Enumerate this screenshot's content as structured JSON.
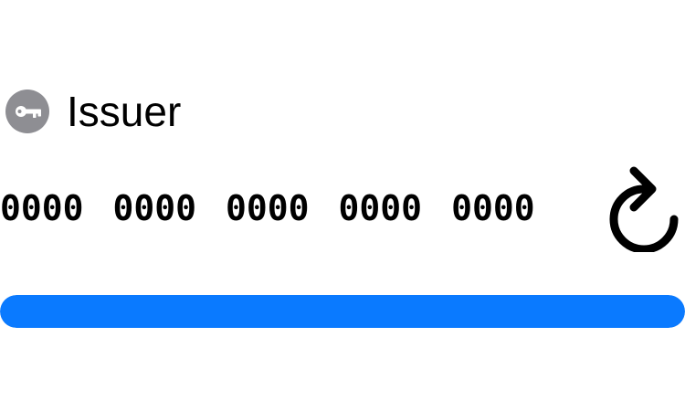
{
  "account": {
    "issuer": "Issuer",
    "icon": "key-icon"
  },
  "code": {
    "groups": [
      "0000",
      "0000",
      "0000",
      "0000",
      "0000"
    ]
  },
  "refresh": {
    "icon": "refresh-icon"
  },
  "progress": {
    "fraction": 1.0,
    "color": "#0A7AFF"
  },
  "colors": {
    "badge": "#8E8E93",
    "accent": "#0A7AFF"
  }
}
